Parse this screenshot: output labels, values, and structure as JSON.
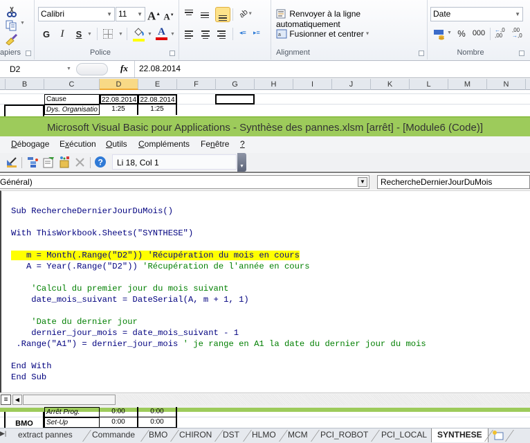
{
  "ribbon": {
    "clipboard": {
      "label": "apiers",
      "icons": [
        "cut-icon",
        "copy-icon",
        "format-painter-icon"
      ]
    },
    "font": {
      "label": "Police",
      "font_name": "Calibri",
      "font_size": "11",
      "grow_font": "A",
      "shrink_font": "A",
      "bold": "G",
      "italic": "I",
      "underline": "S",
      "fill_color": "#ffff00",
      "font_color": "#e00000"
    },
    "alignment": {
      "label": "Alignment",
      "wrap_text": "Renvoyer à la ligne automatiquement",
      "merge_center": "Fusionner et centrer"
    },
    "number": {
      "label": "Nombre",
      "format": "Date",
      "percent": "%",
      "thousands": "000",
      "increase_decimal": "←,0 ,00",
      "decrease_decimal": ",00 →,0"
    }
  },
  "formula_bar": {
    "name_box": "D2",
    "fx": "fx",
    "value": "22.08.2014"
  },
  "grid": {
    "columns": [
      "B",
      "C",
      "D",
      "E",
      "F",
      "G",
      "H",
      "I",
      "J",
      "K",
      "L",
      "M",
      "N"
    ],
    "selected_column": "D",
    "rows": [
      {
        "C": "Cause",
        "D": "22.08.2014",
        "E": "22.08.2014"
      },
      {
        "C": "Dys. Organisatio",
        "D": "1:25",
        "E": "1:25"
      }
    ],
    "bottom_rows": [
      {
        "B": "",
        "C": "Arrêt Prog.",
        "D": "0:00",
        "E": "0:00"
      },
      {
        "B": "BMO",
        "C": "Set-Up",
        "D": "0:00",
        "E": "0:00"
      }
    ]
  },
  "vba": {
    "title": "Microsoft Visual Basic pour Applications - Synthèse des pannes.xlsm [arrêt] - [Module6 (Code)]",
    "menu": [
      {
        "label": "Débogage",
        "u": "D"
      },
      {
        "label": "Exécution",
        "u": "x"
      },
      {
        "label": "Outils",
        "u": "O"
      },
      {
        "label": "Compléments",
        "u": "C"
      },
      {
        "label": "Fenêtre",
        "u": "n"
      },
      {
        "label": "?",
        "u": "?"
      }
    ],
    "toolbar_icons": [
      "design-mode-icon",
      "project-explorer-icon",
      "properties-icon",
      "object-browser-icon",
      "toolbox-icon",
      "help-icon"
    ],
    "cursor_position": "Li 18, Col 1",
    "object_combo": "Général)",
    "procedure_combo": "RechercheDernierJourDuMois",
    "code_lines": [
      {
        "type": "code",
        "text": "Sub RechercheDernierJourDuMois()"
      },
      {
        "type": "blank",
        "text": ""
      },
      {
        "type": "code",
        "text": "With ThisWorkbook.Sheets(\"SYNTHESE\")"
      },
      {
        "type": "blank",
        "text": ""
      },
      {
        "type": "highlight",
        "text": "   m = Month(.Range(\"D2\")) 'Récupération du mois en cours"
      },
      {
        "type": "code_comment",
        "code": "   A = Year(.Range(\"D2\")) ",
        "comment": "'Récupération de l'année en cours"
      },
      {
        "type": "blank",
        "text": ""
      },
      {
        "type": "comment",
        "text": "    'Calcul du premier jour du mois suivant"
      },
      {
        "type": "code",
        "text": "    date_mois_suivant = DateSerial(A, m + 1, 1)"
      },
      {
        "type": "blank",
        "text": ""
      },
      {
        "type": "comment",
        "text": "    'Date du dernier jour"
      },
      {
        "type": "code",
        "text": "    dernier_jour_mois = date_mois_suivant - 1"
      },
      {
        "type": "code_comment",
        "code": " .Range(\"A1\") = dernier_jour_mois ",
        "comment": "' je range en A1 la date du dernier jour du mois"
      },
      {
        "type": "blank",
        "text": ""
      },
      {
        "type": "code",
        "text": "End With"
      },
      {
        "type": "code",
        "text": "End Sub"
      }
    ]
  },
  "sheet_tabs": [
    "extract pannes",
    "Commande",
    "BMO",
    "CHIRON",
    "DST",
    "HLMO",
    "MCM",
    "PCI_ROBOT",
    "PCI_LOCAL",
    "SYNTHESE"
  ],
  "active_tab": "SYNTHESE"
}
